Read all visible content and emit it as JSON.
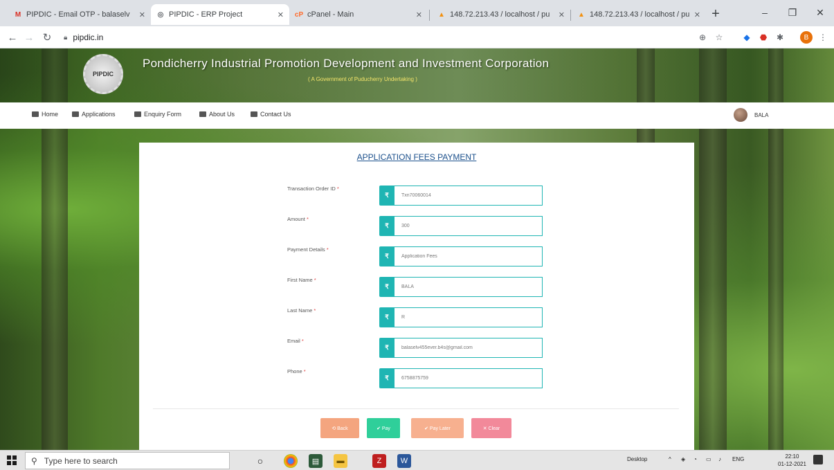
{
  "browser": {
    "tabs": [
      {
        "label": "PIPDIC - Email OTP - balaselv",
        "icon": "gmail-icon",
        "active": false
      },
      {
        "label": "PIPDIC - ERP Project",
        "icon": "globe-icon",
        "active": true
      },
      {
        "label": "cPanel - Main",
        "icon": "cpanel-icon",
        "active": false
      },
      {
        "label": "148.72.213.43 / localhost / pu",
        "icon": "phpmyadmin-icon",
        "active": false
      },
      {
        "label": "148.72.213.43 / localhost / pu",
        "icon": "phpmyadmin-icon",
        "active": false
      }
    ],
    "new_tab": "+",
    "minimize": "–",
    "restore": "❐",
    "close": "✕",
    "url": "pipdic.in",
    "profile_initial": "B"
  },
  "header": {
    "org_title": "Pondicherry Industrial Promotion Development and Investment Corporation",
    "org_subtitle": "( A Government of Puducherry Undertaking )",
    "emblem_text": "PIPDIC"
  },
  "nav": {
    "items": [
      {
        "label": "Home",
        "icon": "home-icon"
      },
      {
        "label": "Applications",
        "icon": "monitor-icon"
      },
      {
        "label": "Enquiry Form",
        "icon": "folder-icon"
      },
      {
        "label": "About Us",
        "icon": "monitor-icon"
      },
      {
        "label": "Contact Us",
        "icon": "phone-icon"
      }
    ],
    "user_name": "BALA"
  },
  "form": {
    "title": "APPLICATION FEES PAYMENT",
    "fields": [
      {
        "label": "Transaction Order ID",
        "value": "Txn70060014",
        "addon": "₹"
      },
      {
        "label": "Amount",
        "value": "300",
        "addon": "₹"
      },
      {
        "label": "Payment Details",
        "value": "Application Fees",
        "addon": "₹"
      },
      {
        "label": "First Name",
        "value": "BALA",
        "addon": "₹"
      },
      {
        "label": "Last Name",
        "value": "R",
        "addon": "₹"
      },
      {
        "label": "Email",
        "value": "balaselv455ever.b4s@gmail.com",
        "addon": "₹"
      },
      {
        "label": "Phone",
        "value": "6758875759",
        "addon": "₹"
      }
    ],
    "required_mark": "*",
    "buttons": {
      "back": "⟲ Back",
      "pay": "✔ Pay",
      "pay_later": "✔ Pay Later",
      "clear": "✕ Clear"
    },
    "colors": {
      "accent": "#1fb5b3",
      "back": "#f4a57f",
      "pay": "#2fcf9a",
      "pay_later": "#f7b08f",
      "clear": "#f2899a"
    }
  },
  "taskbar": {
    "search_placeholder": "Type here to search",
    "desktop_label": "Desktop",
    "language": "ENG",
    "time": "22:10",
    "date": "01-12-2021"
  }
}
